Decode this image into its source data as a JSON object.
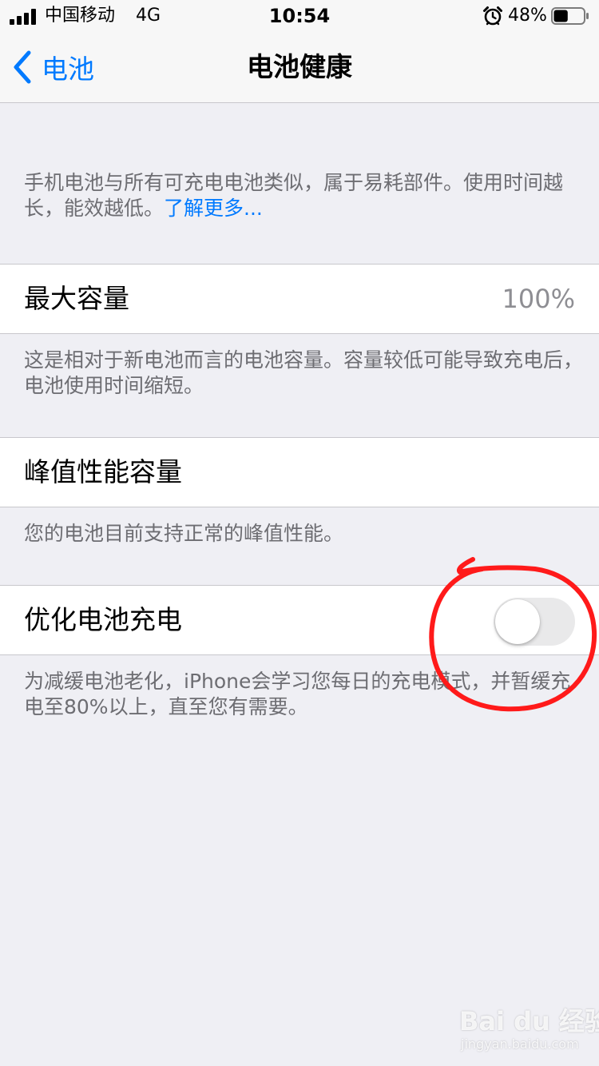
{
  "status_bar": {
    "carrier": "中国移动",
    "network": "4G",
    "time": "10:54",
    "battery_percent": "48%",
    "battery_level": 0.48,
    "icons": [
      "signal-icon",
      "alarm-icon",
      "battery-icon"
    ]
  },
  "nav": {
    "back_label": "电池",
    "title": "电池健康",
    "icons": [
      "chevron-left-icon"
    ]
  },
  "intro": {
    "text": "手机电池与所有可充电电池类似，属于易耗部件。使用时间越长，能效越低。",
    "link": "了解更多..."
  },
  "max_capacity": {
    "label": "最大容量",
    "value": "100%",
    "footnote": "这是相对于新电池而言的电池容量。容量较低可能导致充电后，电池使用时间缩短。"
  },
  "peak_performance": {
    "label": "峰值性能容量",
    "footnote": "您的电池目前支持正常的峰值性能。"
  },
  "optimized_charging": {
    "label": "优化电池充电",
    "enabled": false,
    "footnote": "为减缓电池老化，iPhone会学习您每日的充电模式，并暂缓充电至80%以上，直至您有需要。"
  },
  "watermark": {
    "main": "Bai du 经验",
    "sub": "jingyan.baidu.com"
  },
  "colors": {
    "accent": "#007aff",
    "background": "#efeff4",
    "annotation": "#ff1a1a",
    "toggle_off": "#e9e9ea"
  }
}
